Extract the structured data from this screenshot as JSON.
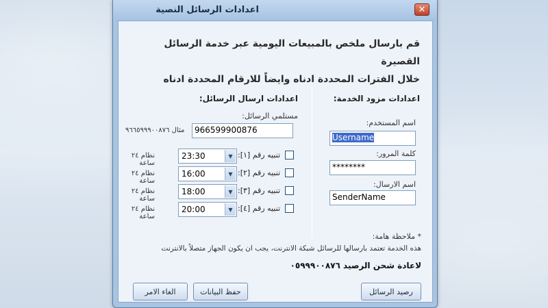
{
  "window": {
    "title": "اعدادات الرسائل النصية",
    "close_glyph": "✕"
  },
  "intro": {
    "line1": "قم بارسال ملخص بالمبيعات اليومية عبر خدمة الرسائل القصيرة",
    "line2": "خلال الفترات المحددة ادناه وايضاً للارقام المحددة ادناه"
  },
  "provider": {
    "section_title": "اعدادات مزود الخدمة:",
    "username_label": "اسم المستخدم:",
    "username_value": "Username",
    "password_label": "كلمة المرور:",
    "password_value": "********",
    "sender_label": "اسم الارسال:",
    "sender_value": "SenderName"
  },
  "sending": {
    "section_title": "اعدادات ارسال الرسائل:",
    "recipients_label": "مستلمي الرسائل:",
    "recipients_value": "966599900876",
    "example_text": "مثال ٩٦٦٥٩٩٩٠٠٨٧٦",
    "alerts": [
      {
        "label": "تنبيه رقم [١]:",
        "time": "23:30",
        "system": "نظام ٢٤ ساعة"
      },
      {
        "label": "تنبيه رقم [٢]:",
        "time": "16:00",
        "system": "نظام ٢٤ ساعة"
      },
      {
        "label": "تنبيه رقم [٣]:",
        "time": "18:00",
        "system": "نظام ٢٤ ساعة"
      },
      {
        "label": "تنبيه رقم [٤]:",
        "time": "20:00",
        "system": "نظام ٢٤ ساعة"
      }
    ]
  },
  "note": {
    "title": "* ملاحظة هامة:",
    "text": "هذه الخدمة تعتمد بارسالها للرسائل شبكة الانترنت، يجب ان يكون الجهاز متصلاً بالانترنت",
    "recharge": "لاعادة شحن الرصيد ٠٥٩٩٩٠٠٨٧٦"
  },
  "buttons": {
    "balance": "رصيد الرسائل",
    "save": "حفظ البيانات",
    "cancel": "الغاء الامر"
  }
}
